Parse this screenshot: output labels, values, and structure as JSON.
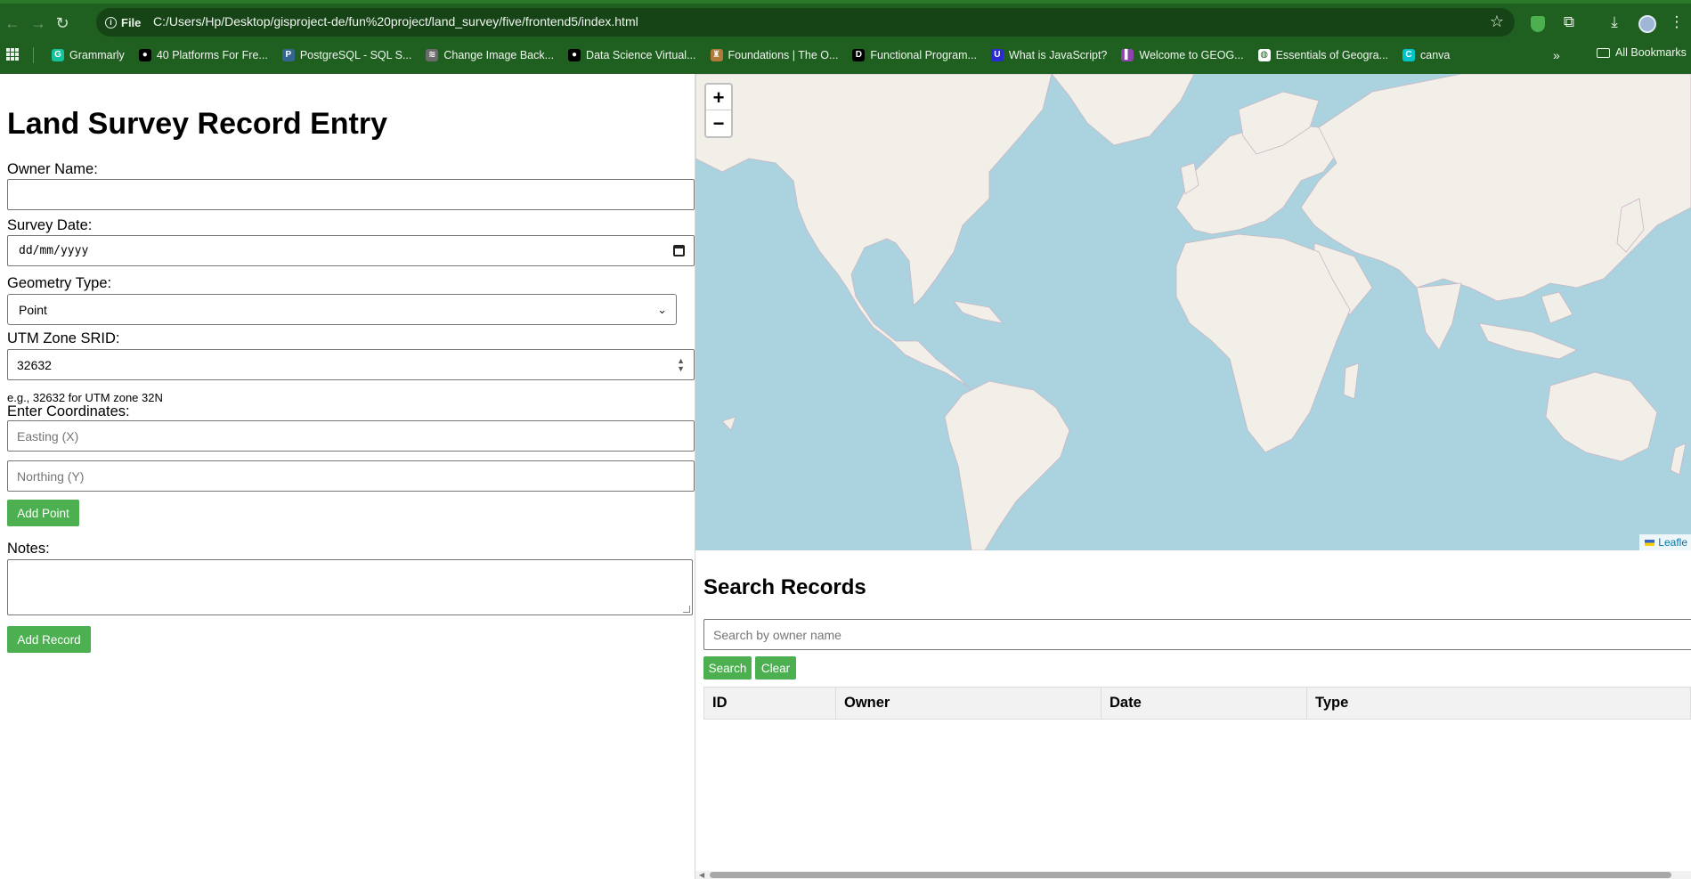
{
  "browser": {
    "url": "C:/Users/Hp/Desktop/gisproject-de/fun%20project/land_survey/five/frontend5/index.html",
    "scheme_label": "File",
    "bookmarks": [
      {
        "label": "Grammarly",
        "icon": "grammarly-icon",
        "color": "#15c39a",
        "glyph": "G"
      },
      {
        "label": "40 Platforms For Fre...",
        "icon": "medium-icon",
        "color": "#000000",
        "glyph": "●"
      },
      {
        "label": "PostgreSQL - SQL S...",
        "icon": "postgresql-icon",
        "color": "#336791",
        "glyph": "P"
      },
      {
        "label": "Change Image Back...",
        "icon": "layers-icon",
        "color": "#6b6b6b",
        "glyph": "≋"
      },
      {
        "label": "Data Science Virtual...",
        "icon": "medium-icon",
        "color": "#000000",
        "glyph": "●"
      },
      {
        "label": "Foundations | The O...",
        "icon": "odin-icon",
        "color": "#b07a3a",
        "glyph": "♜"
      },
      {
        "label": "Functional Program...",
        "icon": "dev-icon",
        "color": "#000000",
        "glyph": "D"
      },
      {
        "label": "What is JavaScript?",
        "icon": "mdn-icon",
        "color": "#2b2bd6",
        "glyph": "U"
      },
      {
        "label": "Welcome to GEOG...",
        "icon": "geog-icon",
        "color": "#8e44ad",
        "glyph": "▌"
      },
      {
        "label": "Essentials of Geogra...",
        "icon": "globe-icon",
        "color": "#ffffff",
        "glyph": "◍"
      },
      {
        "label": "canva",
        "icon": "canva-icon",
        "color": "#00c4cc",
        "glyph": "C"
      }
    ],
    "all_bookmarks": "All Bookmarks"
  },
  "form": {
    "title": "Land Survey Record Entry",
    "owner_label": "Owner Name:",
    "owner_value": "",
    "date_label": "Survey Date:",
    "date_placeholder": "dd/mm/yyyy",
    "geometry_label": "Geometry Type:",
    "geometry_value": "Point",
    "srid_label": "UTM Zone SRID:",
    "srid_value": "32632",
    "srid_hint": "e.g., 32632 for UTM zone 32N",
    "coords_label": "Enter Coordinates:",
    "easting_placeholder": "Easting (X)",
    "northing_placeholder": "Northing (Y)",
    "add_point": "Add Point",
    "notes_label": "Notes:",
    "notes_value": "",
    "add_record": "Add Record"
  },
  "map": {
    "zoom_in": "+",
    "zoom_out": "−",
    "attribution": "Leafle"
  },
  "search": {
    "title": "Search Records",
    "placeholder": "Search by owner name",
    "search_button": "Search",
    "clear_button": "Clear",
    "columns": [
      "ID",
      "Owner",
      "Date",
      "Type"
    ],
    "rows": []
  },
  "colors": {
    "accent": "#4caf50",
    "chrome": "#1f5f1f",
    "sea": "#aad3df",
    "land": "#f2efe9"
  }
}
